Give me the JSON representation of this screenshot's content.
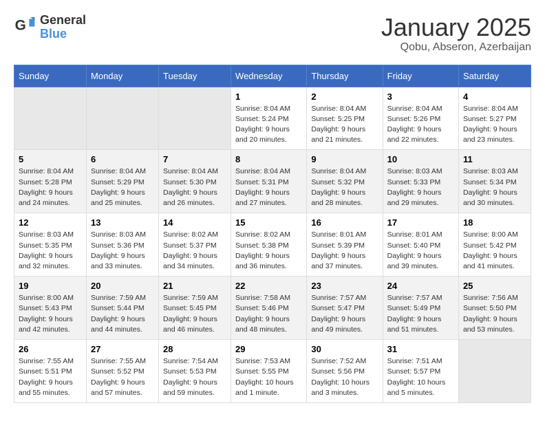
{
  "logo": {
    "text_general": "General",
    "text_blue": "Blue"
  },
  "title": "January 2025",
  "subtitle": "Qobu, Abseron, Azerbaijan",
  "days_of_week": [
    "Sunday",
    "Monday",
    "Tuesday",
    "Wednesday",
    "Thursday",
    "Friday",
    "Saturday"
  ],
  "weeks": [
    [
      {
        "day": "",
        "info": "",
        "empty": true
      },
      {
        "day": "",
        "info": "",
        "empty": true
      },
      {
        "day": "",
        "info": "",
        "empty": true
      },
      {
        "day": "1",
        "info": "Sunrise: 8:04 AM\nSunset: 5:24 PM\nDaylight: 9 hours\nand 20 minutes."
      },
      {
        "day": "2",
        "info": "Sunrise: 8:04 AM\nSunset: 5:25 PM\nDaylight: 9 hours\nand 21 minutes."
      },
      {
        "day": "3",
        "info": "Sunrise: 8:04 AM\nSunset: 5:26 PM\nDaylight: 9 hours\nand 22 minutes."
      },
      {
        "day": "4",
        "info": "Sunrise: 8:04 AM\nSunset: 5:27 PM\nDaylight: 9 hours\nand 23 minutes."
      }
    ],
    [
      {
        "day": "5",
        "info": "Sunrise: 8:04 AM\nSunset: 5:28 PM\nDaylight: 9 hours\nand 24 minutes."
      },
      {
        "day": "6",
        "info": "Sunrise: 8:04 AM\nSunset: 5:29 PM\nDaylight: 9 hours\nand 25 minutes."
      },
      {
        "day": "7",
        "info": "Sunrise: 8:04 AM\nSunset: 5:30 PM\nDaylight: 9 hours\nand 26 minutes."
      },
      {
        "day": "8",
        "info": "Sunrise: 8:04 AM\nSunset: 5:31 PM\nDaylight: 9 hours\nand 27 minutes."
      },
      {
        "day": "9",
        "info": "Sunrise: 8:04 AM\nSunset: 5:32 PM\nDaylight: 9 hours\nand 28 minutes."
      },
      {
        "day": "10",
        "info": "Sunrise: 8:03 AM\nSunset: 5:33 PM\nDaylight: 9 hours\nand 29 minutes."
      },
      {
        "day": "11",
        "info": "Sunrise: 8:03 AM\nSunset: 5:34 PM\nDaylight: 9 hours\nand 30 minutes."
      }
    ],
    [
      {
        "day": "12",
        "info": "Sunrise: 8:03 AM\nSunset: 5:35 PM\nDaylight: 9 hours\nand 32 minutes."
      },
      {
        "day": "13",
        "info": "Sunrise: 8:03 AM\nSunset: 5:36 PM\nDaylight: 9 hours\nand 33 minutes."
      },
      {
        "day": "14",
        "info": "Sunrise: 8:02 AM\nSunset: 5:37 PM\nDaylight: 9 hours\nand 34 minutes."
      },
      {
        "day": "15",
        "info": "Sunrise: 8:02 AM\nSunset: 5:38 PM\nDaylight: 9 hours\nand 36 minutes."
      },
      {
        "day": "16",
        "info": "Sunrise: 8:01 AM\nSunset: 5:39 PM\nDaylight: 9 hours\nand 37 minutes."
      },
      {
        "day": "17",
        "info": "Sunrise: 8:01 AM\nSunset: 5:40 PM\nDaylight: 9 hours\nand 39 minutes."
      },
      {
        "day": "18",
        "info": "Sunrise: 8:00 AM\nSunset: 5:42 PM\nDaylight: 9 hours\nand 41 minutes."
      }
    ],
    [
      {
        "day": "19",
        "info": "Sunrise: 8:00 AM\nSunset: 5:43 PM\nDaylight: 9 hours\nand 42 minutes."
      },
      {
        "day": "20",
        "info": "Sunrise: 7:59 AM\nSunset: 5:44 PM\nDaylight: 9 hours\nand 44 minutes."
      },
      {
        "day": "21",
        "info": "Sunrise: 7:59 AM\nSunset: 5:45 PM\nDaylight: 9 hours\nand 46 minutes."
      },
      {
        "day": "22",
        "info": "Sunrise: 7:58 AM\nSunset: 5:46 PM\nDaylight: 9 hours\nand 48 minutes."
      },
      {
        "day": "23",
        "info": "Sunrise: 7:57 AM\nSunset: 5:47 PM\nDaylight: 9 hours\nand 49 minutes."
      },
      {
        "day": "24",
        "info": "Sunrise: 7:57 AM\nSunset: 5:49 PM\nDaylight: 9 hours\nand 51 minutes."
      },
      {
        "day": "25",
        "info": "Sunrise: 7:56 AM\nSunset: 5:50 PM\nDaylight: 9 hours\nand 53 minutes."
      }
    ],
    [
      {
        "day": "26",
        "info": "Sunrise: 7:55 AM\nSunset: 5:51 PM\nDaylight: 9 hours\nand 55 minutes."
      },
      {
        "day": "27",
        "info": "Sunrise: 7:55 AM\nSunset: 5:52 PM\nDaylight: 9 hours\nand 57 minutes."
      },
      {
        "day": "28",
        "info": "Sunrise: 7:54 AM\nSunset: 5:53 PM\nDaylight: 9 hours\nand 59 minutes."
      },
      {
        "day": "29",
        "info": "Sunrise: 7:53 AM\nSunset: 5:55 PM\nDaylight: 10 hours\nand 1 minute."
      },
      {
        "day": "30",
        "info": "Sunrise: 7:52 AM\nSunset: 5:56 PM\nDaylight: 10 hours\nand 3 minutes."
      },
      {
        "day": "31",
        "info": "Sunrise: 7:51 AM\nSunset: 5:57 PM\nDaylight: 10 hours\nand 5 minutes."
      },
      {
        "day": "",
        "info": "",
        "empty": true
      }
    ]
  ]
}
